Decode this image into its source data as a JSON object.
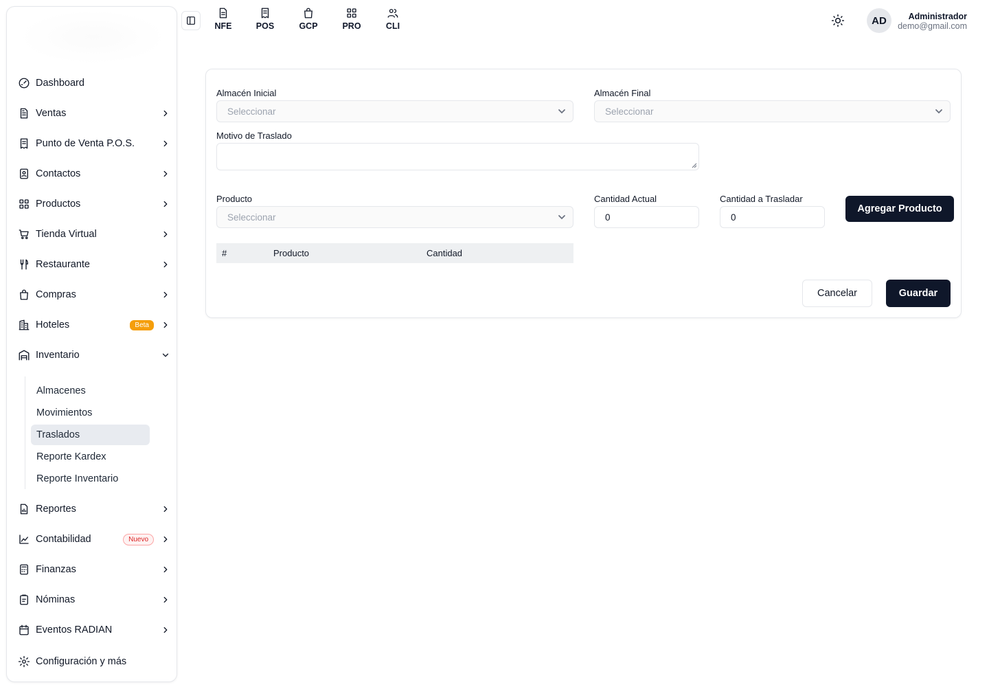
{
  "sidebar": {
    "items": [
      {
        "label": "Dashboard",
        "icon": "gauge-icon",
        "has_children": false
      },
      {
        "label": "Ventas",
        "icon": "document-icon",
        "has_children": true
      },
      {
        "label": "Punto de Venta P.O.S.",
        "icon": "receipt-icon",
        "has_children": true
      },
      {
        "label": "Contactos",
        "icon": "contact-card-icon",
        "has_children": true
      },
      {
        "label": "Productos",
        "icon": "grid-icon",
        "has_children": true
      },
      {
        "label": "Tienda Virtual",
        "icon": "cart-icon",
        "has_children": true
      },
      {
        "label": "Restaurante",
        "icon": "utensils-icon",
        "has_children": true
      },
      {
        "label": "Compras",
        "icon": "bag-icon",
        "has_children": true
      },
      {
        "label": "Hoteles",
        "icon": "building-icon",
        "has_children": true,
        "badge": "Beta"
      },
      {
        "label": "Inventario",
        "icon": "warehouse-icon",
        "has_children": true,
        "expanded": true
      },
      {
        "label": "Reportes",
        "icon": "report-icon",
        "has_children": true
      },
      {
        "label": "Contabilidad",
        "icon": "chart-icon",
        "has_children": true,
        "badge": "Nuevo"
      },
      {
        "label": "Finanzas",
        "icon": "calculator-icon",
        "has_children": true
      },
      {
        "label": "Nóminas",
        "icon": "clipboard-icon",
        "has_children": true
      },
      {
        "label": "Eventos RADIAN",
        "icon": "calendar-icon",
        "has_children": true
      },
      {
        "label": "Configuración y más",
        "icon": "gear-icon",
        "has_children": false
      }
    ],
    "inventario_sub": [
      "Almacenes",
      "Movimientos",
      "Traslados",
      "Reporte Kardex",
      "Reporte Inventario"
    ],
    "active_sub": "Traslados"
  },
  "topbar": {
    "shortcuts": [
      "NFE",
      "POS",
      "GCP",
      "PRO",
      "CLI"
    ],
    "user": {
      "initials": "AD",
      "name": "Administrador",
      "email": "demo@gmail.com"
    }
  },
  "form": {
    "almacen_inicial": {
      "label": "Almacén Inicial",
      "placeholder": "Seleccionar"
    },
    "almacen_final": {
      "label": "Almacén Final",
      "placeholder": "Seleccionar"
    },
    "motivo": {
      "label": "Motivo de Traslado",
      "value": ""
    },
    "producto": {
      "label": "Producto",
      "placeholder": "Seleccionar"
    },
    "cantidad_actual": {
      "label": "Cantidad Actual",
      "value": "0"
    },
    "cantidad_trasladar": {
      "label": "Cantidad a Trasladar",
      "value": "0"
    },
    "add_button": "Agregar Producto",
    "table_headers": [
      "#",
      "Producto",
      "Cantidad"
    ],
    "cancel_button": "Cancelar",
    "save_button": "Guardar"
  },
  "colors": {
    "primary_button": "#0f172a",
    "beta_badge": "#f59e0b",
    "nuevo_badge": "#dc2626",
    "active_sub_bg": "#e8ebf0"
  }
}
